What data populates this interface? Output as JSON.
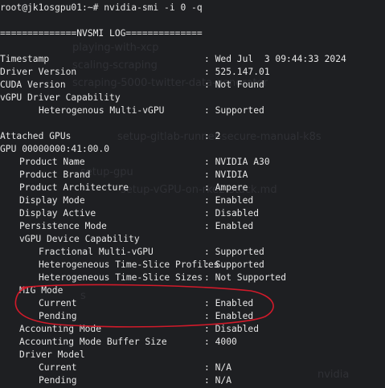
{
  "background_colors": {
    "terminal": "#1e1f22",
    "text": "#e6e6e6",
    "annotation": "#d11a2a"
  },
  "ghost_text": [
    "playing-with-xcp",
    "scaling-scraping",
    "scraping-5000-twitter-data-generator",
    "setup-gitlab-runner-secure-manual-k8s",
    "setup-gpu",
    "setup-vGPU-on-rke2-stack.md",
    "nvidia",
    "s"
  ],
  "prompt": "root@jk1osgpu01:~# nvidia-smi -i 0 -q",
  "log_header": "==============NVSMI LOG==============",
  "top": [
    {
      "key": "Timestamp",
      "value": ": Wed Jul  3 09:44:33 2024",
      "indent": 0
    },
    {
      "key": "Driver Version",
      "value": ": 525.147.01",
      "indent": 0
    },
    {
      "key": "CUDA Version",
      "value": ": Not Found",
      "indent": 0
    },
    {
      "key": "vGPU Driver Capability",
      "value": "",
      "indent": 0
    },
    {
      "key": "Heterogenous Multi-vGPU",
      "value": ": Supported",
      "indent": 2
    }
  ],
  "gpus": [
    {
      "key": "Attached GPUs",
      "value": ": 2",
      "indent": 0
    },
    {
      "key": "GPU 00000000:41:00.0",
      "value": "",
      "indent": 0
    },
    {
      "key": "Product Name",
      "value": ": NVIDIA A30",
      "indent": 1
    },
    {
      "key": "Product Brand",
      "value": ": NVIDIA",
      "indent": 1
    },
    {
      "key": "Product Architecture",
      "value": ": Ampere",
      "indent": 1
    },
    {
      "key": "Display Mode",
      "value": ": Enabled",
      "indent": 1
    },
    {
      "key": "Display Active",
      "value": ": Disabled",
      "indent": 1
    },
    {
      "key": "Persistence Mode",
      "value": ": Enabled",
      "indent": 1
    },
    {
      "key": "vGPU Device Capability",
      "value": "",
      "indent": 1
    },
    {
      "key": "Fractional Multi-vGPU",
      "value": ": Supported",
      "indent": 2
    },
    {
      "key": "Heterogeneous Time-Slice Profiles",
      "value": ": Supported",
      "indent": 2
    },
    {
      "key": "Heterogeneous Time-Slice Sizes",
      "value": ": Not Supported",
      "indent": 2
    },
    {
      "key": "MIG Mode",
      "value": "",
      "indent": 1
    },
    {
      "key": "Current",
      "value": ": Enabled",
      "indent": 2
    },
    {
      "key": "Pending",
      "value": ": Enabled",
      "indent": 2
    },
    {
      "key": "Accounting Mode",
      "value": ": Disabled",
      "indent": 1
    },
    {
      "key": "Accounting Mode Buffer Size",
      "value": ": 4000",
      "indent": 1
    },
    {
      "key": "Driver Model",
      "value": "",
      "indent": 1
    },
    {
      "key": "Current",
      "value": ": N/A",
      "indent": 2
    },
    {
      "key": "Pending",
      "value": ": N/A",
      "indent": 2
    }
  ]
}
